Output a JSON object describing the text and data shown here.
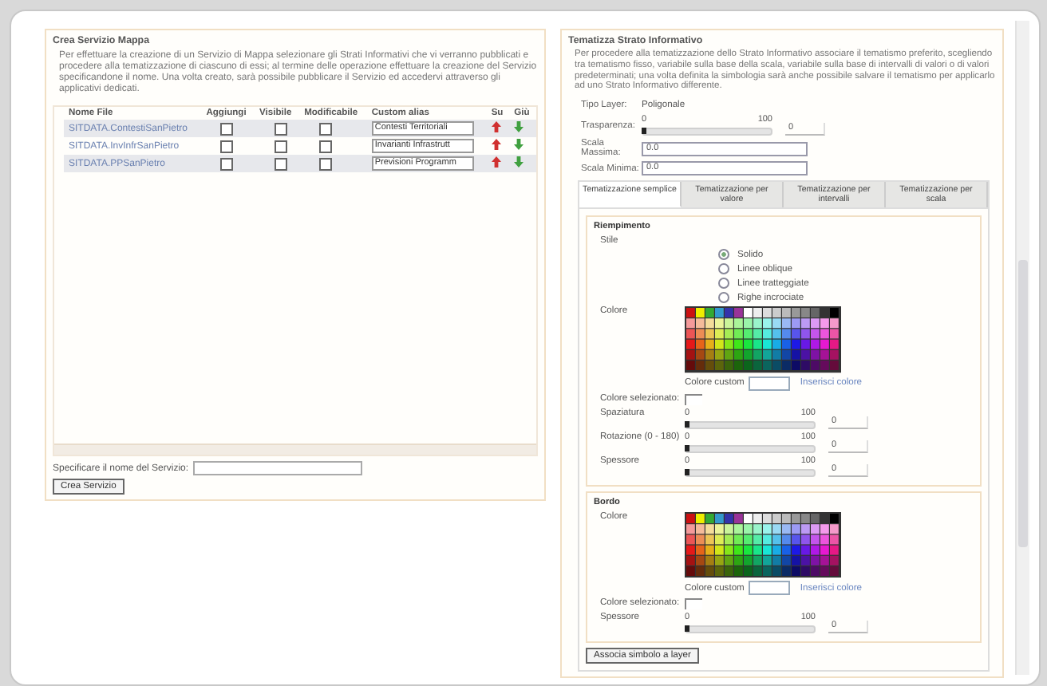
{
  "service_panel": {
    "title": "Crea Servizio Mappa",
    "description": "Per effettuare la creazione di un Servizio di Mappa selezionare gli Strati Informativi che vi verranno pubblicati e procedere alla tematizzazione di ciascuno di essi; al termine delle operazione effettuare la creazione del Servizio specificandone il nome. Una volta creato, sarà possibile pubblicare il Servizio ed accedervi attraverso gli applicativi dedicati.",
    "table": {
      "columns": [
        "Nome File",
        "Aggiungi",
        "Visibile",
        "Modificabile",
        "Custom alias",
        "Su",
        "Giù"
      ],
      "rows": [
        {
          "file": "SITDATA.ContestiSanPietro",
          "add": false,
          "visible": false,
          "editable": false,
          "alias": "Contesti Territoriali"
        },
        {
          "file": "SITDATA.InvInfrSanPietro",
          "add": false,
          "visible": false,
          "editable": false,
          "alias": "Invarianti Infrastrutt"
        },
        {
          "file": "SITDATA.PPSanPietro",
          "add": false,
          "visible": false,
          "editable": false,
          "alias": "Previsioni Programm"
        }
      ]
    },
    "name_label": "Specificare il nome del Servizio:",
    "create_button": "Crea Servizio"
  },
  "theme_panel": {
    "title": "Tematizza Strato Informativo",
    "description": "Per procedere alla tematizzazione dello Strato Informativo associare il tematismo preferito, scegliendo tra tematismo fisso, variabile sulla base della scala, variabile sulla base di intervalli di valori o di valori predeterminati; una volta definita la simbologia sarà anche possibile salvare il tematismo per applicarlo ad uno Strato Informativo differente.",
    "fields": [
      {
        "kind": "text",
        "label": "Tipo Layer:",
        "value": "Poligonale"
      },
      {
        "kind": "slider",
        "label": "Trasparenza:",
        "min": "0",
        "max": "100",
        "level": 0,
        "value": "0"
      },
      {
        "kind": "input",
        "label": "Scala Massima:",
        "value": "0.0"
      },
      {
        "kind": "input",
        "label": "Scala Minima:",
        "value": "0.0"
      }
    ],
    "tabs": [
      {
        "label": "Tematizzazione semplice",
        "selected": true
      },
      {
        "label": "Tematizzazione per valore",
        "selected": false
      },
      {
        "label": "Tematizzazione per intervalli",
        "selected": false
      },
      {
        "label": "Tematizzazione per scala",
        "selected": false
      }
    ],
    "fill": {
      "title": "Riempimento",
      "style_label": "Stile",
      "styles": [
        {
          "label": "Solido",
          "selected": true
        },
        {
          "label": "Linee oblique",
          "selected": false
        },
        {
          "label": "Linee tratteggiate",
          "selected": false
        },
        {
          "label": "Righe incrociate",
          "selected": false
        }
      ],
      "color_label": "Colore",
      "custom_label": "Colore custom",
      "insert_link": "Inserisci colore",
      "selected_color_label": "Colore selezionato:",
      "sliders": [
        {
          "label": "Spaziatura",
          "min": "0",
          "max": "100",
          "level": 0,
          "value": "0"
        },
        {
          "label": "Rotazione (0 - 180)",
          "min": "0",
          "max": "100",
          "level": 0,
          "value": "0"
        },
        {
          "label": "Spessore",
          "min": "0",
          "max": "100",
          "level": 0,
          "value": "0"
        }
      ]
    },
    "border": {
      "title": "Bordo",
      "color_label": "Colore",
      "custom_label": "Colore custom",
      "insert_link": "Inserisci colore",
      "selected_color_label": "Colore selezionato:",
      "sliders": [
        {
          "label": "Spessore",
          "min": "0",
          "max": "100",
          "level": 0,
          "value": "0"
        }
      ]
    },
    "assign_button": "Associa simbolo a layer"
  }
}
